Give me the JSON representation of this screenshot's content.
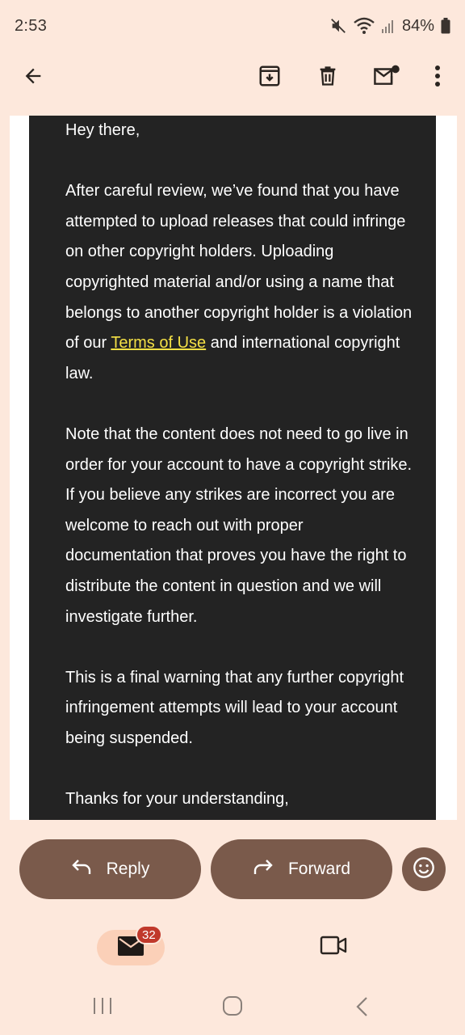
{
  "status_bar": {
    "time": "2:53",
    "battery": "84%",
    "icons": [
      "mute-icon",
      "wifi-icon",
      "signal-icon",
      "battery-icon"
    ]
  },
  "app_bar": {
    "icons": [
      "back-arrow-icon",
      "archive-icon",
      "delete-icon",
      "mark-unread-icon",
      "more-vert-icon"
    ]
  },
  "email": {
    "greeting": "Hey there,",
    "paragraph_1_before_link": "After careful review, we’ve found that you have attempted to upload releases that could infringe on other copyright holders. Uploading copyrighted material and/or using a name that belongs to another copyright holder is a violation of our ",
    "paragraph_1_link": "Terms of Use",
    "paragraph_1_after_link": " and international copyright law.",
    "paragraph_2": "Note that the content does not need to go live in order for your account to have a copyright strike. If you believe any strikes are incorrect you are welcome to reach out with proper documentation that proves you have the right to distribute the content in question and we will investigate further.",
    "paragraph_3": "This is a final warning that any further copyright infringement attempts will lead to your account being suspended.",
    "closing": "Thanks for your understanding,",
    "link_color": "#f4e045",
    "background_color": "#232323"
  },
  "actions": {
    "reply_label": "Reply",
    "forward_label": "Forward",
    "button_color": "#7a5a4b"
  },
  "bottom_nav": {
    "mail_badge": "32",
    "icons": [
      "mail-icon",
      "video-meet-icon"
    ]
  },
  "system_nav": {
    "icons": [
      "recents-icon",
      "home-icon",
      "back-icon"
    ]
  },
  "colors": {
    "background": "#fde8dc",
    "badge": "#c0392b"
  }
}
